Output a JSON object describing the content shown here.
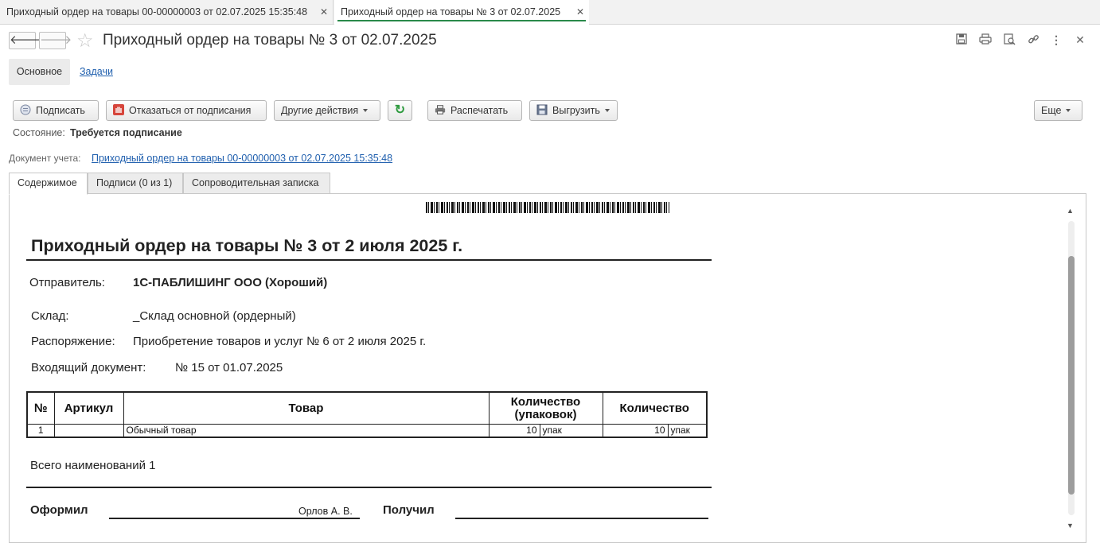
{
  "window_tabs": [
    {
      "label": "Приходный ордер на товары 00-00000003 от 02.07.2025 15:35:48"
    },
    {
      "label": "Приходный ордер на товары № 3 от 02.07.2025"
    }
  ],
  "header": {
    "title": "Приходный ордер на товары № 3 от 02.07.2025"
  },
  "sections": {
    "main": "Основное",
    "tasks": "Задачи"
  },
  "toolbar": {
    "sign": "Подписать",
    "refuse": "Отказаться от подписания",
    "other_actions": "Другие действия",
    "print": "Распечатать",
    "export": "Выгрузить",
    "more": "Еще"
  },
  "state": {
    "label": "Состояние:",
    "value": "Требуется подписание"
  },
  "accounting_doc": {
    "label": "Документ учета:",
    "link": "Приходный ордер на товары 00-00000003 от 02.07.2025 15:35:48"
  },
  "inner_tabs": [
    "Содержимое",
    "Подписи (0 из 1)",
    "Сопроводительная записка"
  ],
  "document": {
    "title": "Приходный ордер на товары № 3 от 2 июля 2025 г.",
    "sender_label": "Отправитель:",
    "sender_value": "1С-ПАБЛИШИНГ ООО (Хороший)",
    "warehouse_label": "Склад:",
    "warehouse_value": "_Склад основной (ордерный)",
    "order_label": "Распоряжение:",
    "order_value": "Приобретение товаров и услуг № 6 от 2 июля 2025 г.",
    "incoming_label": "Входящий документ:",
    "incoming_value": "№ 15 от 01.07.2025",
    "table": {
      "headers": [
        "№",
        "Артикул",
        "Товар",
        "Количество (упаковок)",
        "Количество"
      ],
      "rows": [
        {
          "n": "1",
          "article": "",
          "item": "Обычный товар",
          "qty_pack": "10",
          "unit_pack": "упак",
          "qty": "10",
          "unit": "упак"
        }
      ]
    },
    "total": "Всего наименований 1",
    "made_by_label": "Оформил",
    "made_by_name": "Орлов А. В.",
    "received_label": "Получил"
  }
}
